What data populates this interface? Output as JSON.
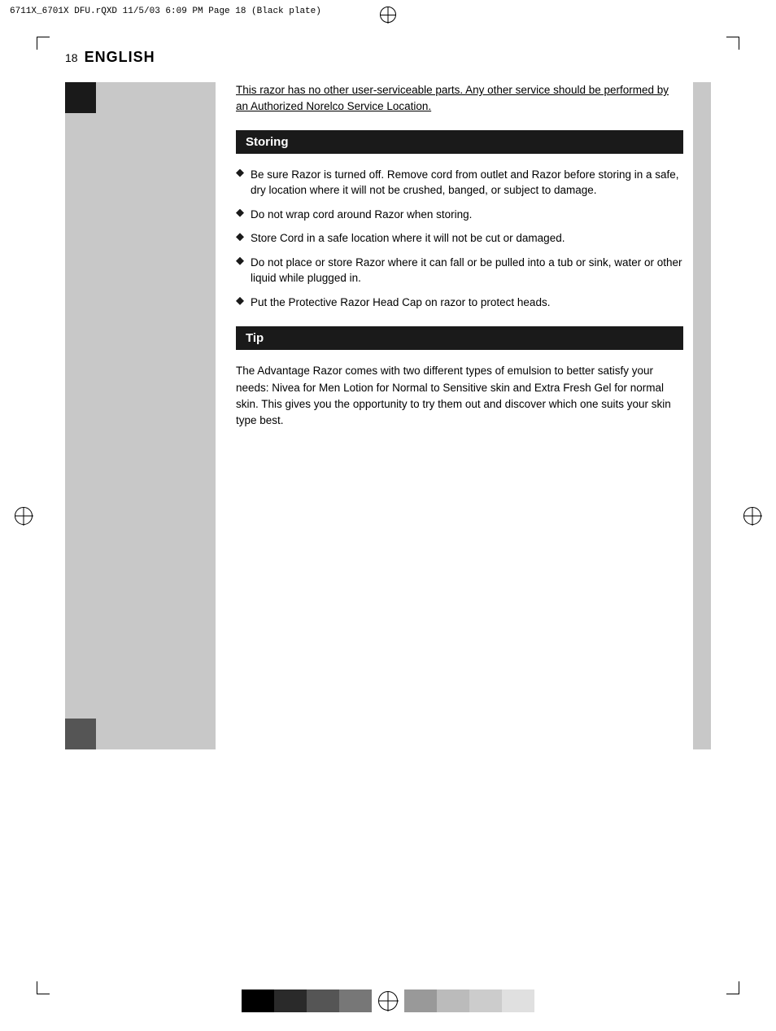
{
  "header": {
    "file_info": "6711X_6701X DFU.rQXD   11/5/03   6:09 PM   Page 18   (Black plate)"
  },
  "page": {
    "number": "18",
    "language": "ENGLISH"
  },
  "intro": {
    "text": "This razor has no other user-serviceable parts. Any other service should be performed by an Authorized Norelco Service Location."
  },
  "storing_section": {
    "title": "Storing",
    "bullets": [
      "Be sure Razor is turned off.  Remove cord from outlet and Razor before storing in a safe, dry location where it will not be crushed, banged, or subject to damage.",
      "Do not wrap cord around Razor when storing.",
      "Store Cord in a safe location where it will not be cut or damaged.",
      "Do not place or store Razor where it can fall or be pulled into a tub or sink, water or other liquid while plugged in.",
      "Put the Protective Razor Head Cap on razor to protect heads."
    ]
  },
  "tip_section": {
    "title": "Tip",
    "text": "The Advantage Razor comes with two different types of emulsion to better satisfy your needs: Nivea for Men Lotion for Normal to Sensitive skin and Extra Fresh Gel for normal skin. This gives you the opportunity to try them out and discover which one suits your skin type best."
  }
}
